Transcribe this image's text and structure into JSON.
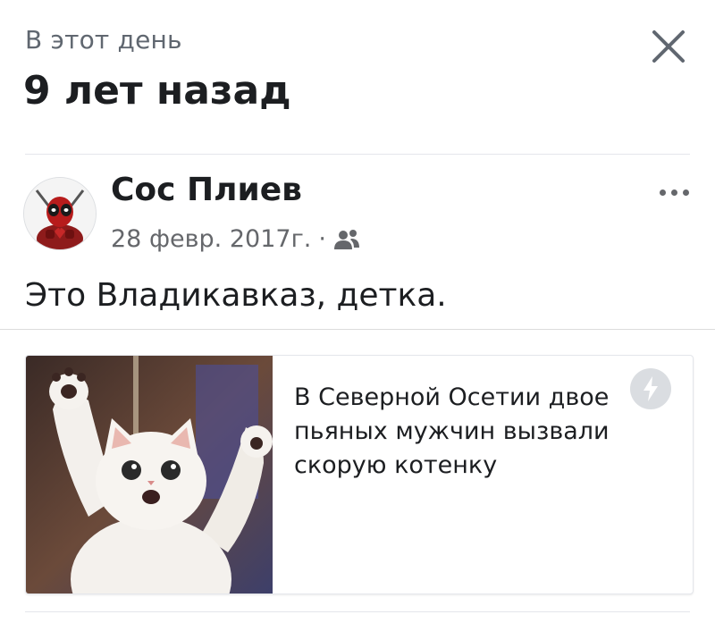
{
  "header": {
    "subtitle": "В этот день",
    "title": "9 лет назад"
  },
  "post": {
    "author": "Сос Плиев",
    "date": "28 февр. 2017г.",
    "separator": "·",
    "audience_icon": "friends-icon",
    "text": "Это Владикавказ, детка."
  },
  "link_card": {
    "title": "В Северной Осетии двое пьяных мужчин вызвали скорую котенку",
    "badge_icon": "amp-lightning-icon"
  },
  "icons": {
    "close": "close-icon",
    "more": "more-options-icon",
    "avatar": "deadpool-avatar"
  },
  "colors": {
    "text_primary": "#1c1e21",
    "text_secondary": "#65676b",
    "divider": "#e4e6eb"
  }
}
